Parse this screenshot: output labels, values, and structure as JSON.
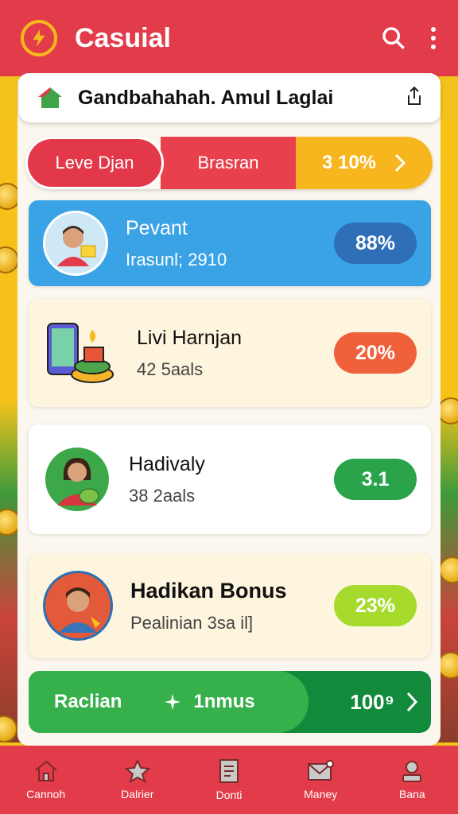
{
  "app": {
    "title": "Casuial",
    "accent": "#e23b4a"
  },
  "location": {
    "text": "Gandbahahah. Amul Laglai"
  },
  "level_bar": {
    "segment_a": "Leve Djan",
    "segment_b": "Brasran",
    "segment_c": "3 10%"
  },
  "cards": [
    {
      "title": "Pevant",
      "subtitle": "Irasunl; 2910",
      "badge": "88%",
      "badge_color": "#2e6fb8"
    },
    {
      "title": "Livi Harnjan",
      "subtitle": "42 5aals",
      "badge": "20%",
      "badge_color": "#f0603a"
    },
    {
      "title": "Hadivaly",
      "subtitle": "38 2aals",
      "badge": "3.1",
      "badge_color": "#2aa34a"
    },
    {
      "title": "Hadikan Bonus",
      "subtitle": "Pealinian 3sa il]",
      "badge": "23%",
      "badge_color": "#a6db2e"
    }
  ],
  "bonus_bar": {
    "left": "Raclian",
    "middle": "1nmus",
    "right": "100⁹"
  },
  "nav": [
    {
      "label": "Cannoh",
      "icon": "home-icon"
    },
    {
      "label": "Dalrier",
      "icon": "star-icon"
    },
    {
      "label": "Donti",
      "icon": "document-icon"
    },
    {
      "label": "Maney",
      "icon": "mail-icon"
    },
    {
      "label": "Bana",
      "icon": "profile-icon"
    }
  ]
}
